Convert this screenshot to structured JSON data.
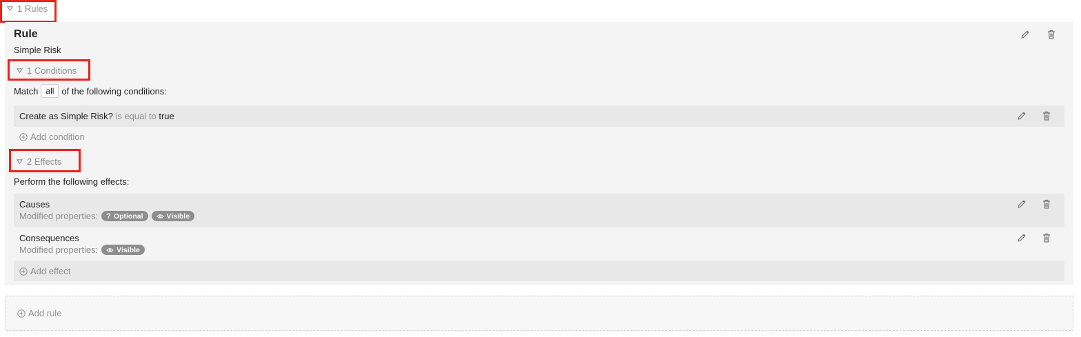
{
  "rules_toggle": {
    "label": "1 Rules"
  },
  "rule": {
    "heading": "Rule",
    "name": "Simple Risk",
    "conditions_toggle": "1 Conditions",
    "match": {
      "prefix": "Match",
      "value": "all",
      "suffix": "of the following conditions:"
    },
    "conditions": [
      {
        "field": "Create as Simple Risk?",
        "operator": "is equal to",
        "value": "true"
      }
    ],
    "add_condition_label": "Add condition",
    "effects_toggle": "2 Effects",
    "effects_intro": "Perform the following effects:",
    "effects": [
      {
        "name": "Causes",
        "modified_label": "Modified properties:",
        "badges": [
          {
            "icon": "question-icon",
            "label": "Optional"
          },
          {
            "icon": "eye-icon",
            "label": "Visible"
          }
        ]
      },
      {
        "name": "Consequences",
        "modified_label": "Modified properties:",
        "badges": [
          {
            "icon": "eye-icon",
            "label": "Visible"
          }
        ]
      }
    ],
    "add_effect_label": "Add effect"
  },
  "add_rule_label": "Add rule",
  "icons": {
    "edit": "pencil-icon",
    "delete": "trash-icon",
    "collapse": "triangle-down-icon",
    "add": "plus-circle-icon"
  },
  "colors": {
    "highlight": "#e8241b",
    "panel": "#f4f4f4",
    "row": "#e8e8e8",
    "badge": "#8e8e8e"
  }
}
